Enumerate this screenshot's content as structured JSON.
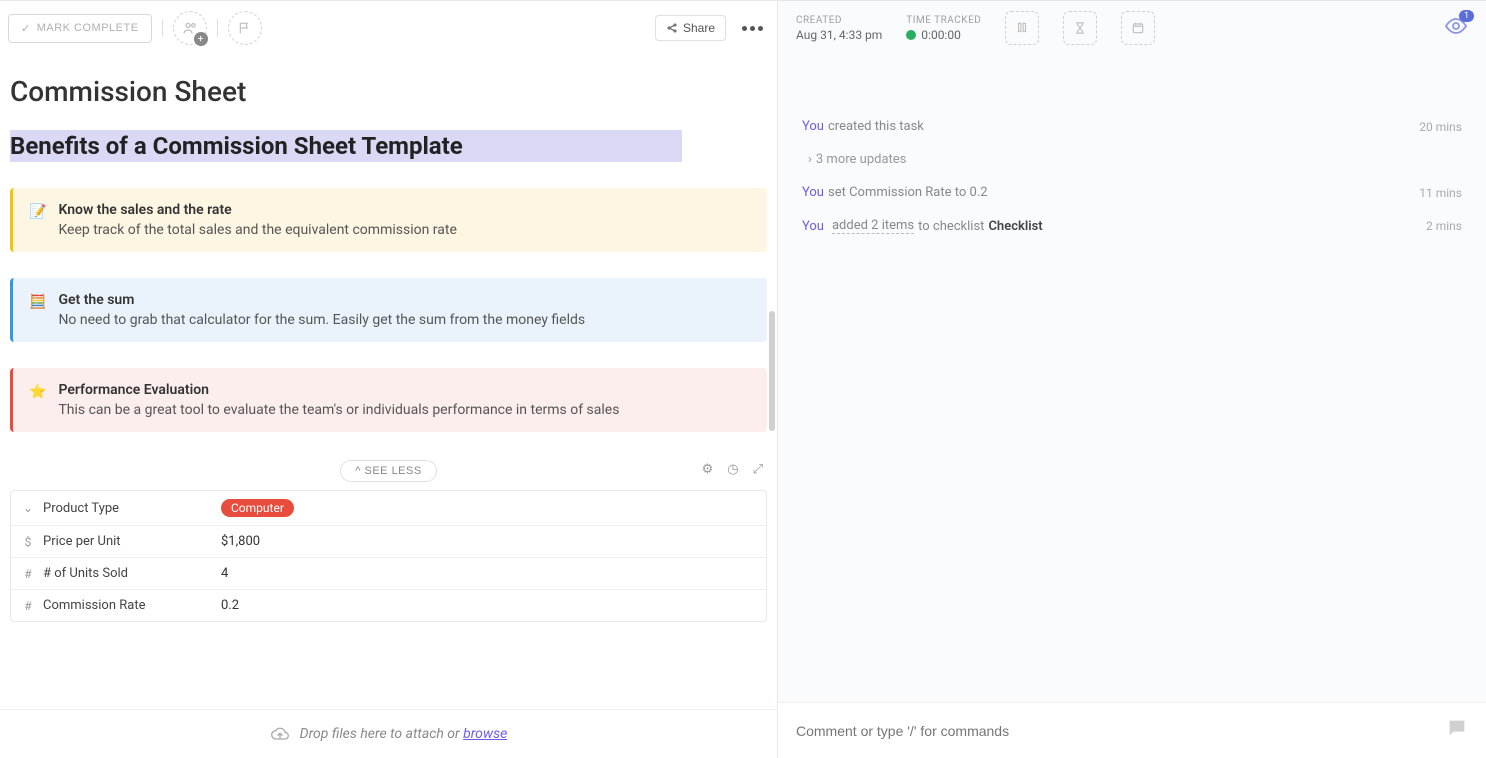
{
  "toolbar": {
    "mark_complete": "MARK COMPLETE",
    "share": "Share"
  },
  "meta": {
    "created_label": "CREATED",
    "created_value": "Aug 31, 4:33 pm",
    "time_tracked_label": "TIME TRACKED",
    "time_tracked_value": "0:00:00",
    "watch_count": "1"
  },
  "task": {
    "title": "Commission Sheet",
    "heading": "Benefits of a Commission Sheet Template"
  },
  "callouts": [
    {
      "icon": "📝",
      "title": "Know the sales and the rate",
      "desc": "Keep track of the total sales and the equivalent commission rate"
    },
    {
      "icon": "🧮",
      "title": "Get the sum",
      "desc": "No need to grab that calculator for the sum. Easily get the sum from the money fields"
    },
    {
      "icon": "⭐",
      "title": "Performance Evaluation",
      "desc": "This can be a great tool to evaluate the team's or individuals performance in terms of sales"
    }
  ],
  "see_less": "^ SEE LESS",
  "fields": [
    {
      "icon": "⌄",
      "label": "Product Type",
      "value": "Computer",
      "chip": true
    },
    {
      "icon": "$",
      "label": "Price per Unit",
      "value": "$1,800"
    },
    {
      "icon": "#",
      "label": "# of Units Sold",
      "value": "4"
    },
    {
      "icon": "#",
      "label": "Commission Rate",
      "value": "0.2"
    }
  ],
  "dropzone": {
    "text": "Drop files here to attach or ",
    "link": "browse"
  },
  "activity": {
    "items": [
      {
        "you": "You",
        "text": "created this task",
        "time": "20 mins"
      },
      {
        "more": "3 more updates"
      },
      {
        "you": "You",
        "text": "set Commission Rate to 0.2",
        "time": "11 mins"
      },
      {
        "you": "You",
        "link": "added 2 items",
        "text2": "to checklist",
        "bold": "Checklist",
        "time": "2 mins"
      }
    ]
  },
  "comment": {
    "placeholder": "Comment or type '/' for commands"
  }
}
